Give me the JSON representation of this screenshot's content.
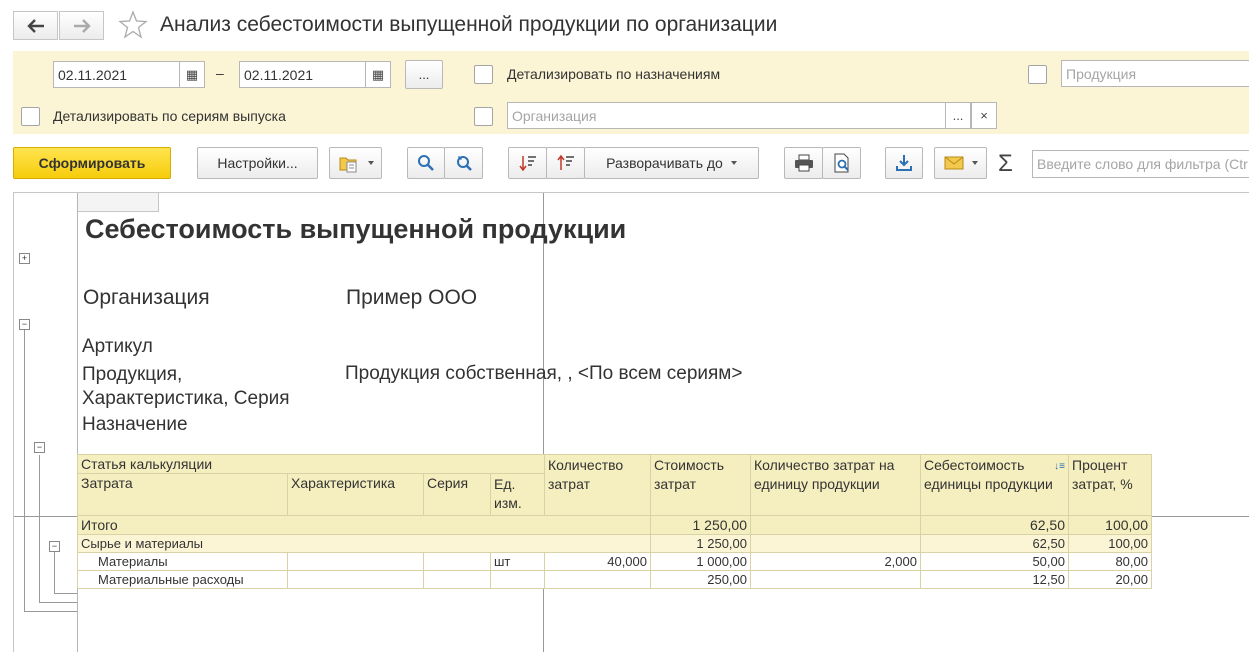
{
  "window": {
    "title": "Анализ себестоимости выпущенной продукции по организации"
  },
  "filters": {
    "date_from": "02.11.2021",
    "date_separator": "–",
    "date_to": "02.11.2021",
    "period_button": "...",
    "detail_by_purpose_label": "Детализировать по назначениям",
    "product_placeholder": "Продукция",
    "detail_by_series_label": "Детализировать по сериям выпуска",
    "organization_placeholder": "Организация",
    "organization_select": "...",
    "organization_clear": "×"
  },
  "toolbar": {
    "generate_label": "Сформировать",
    "settings_label": "Настройки...",
    "expand_label": "Разворачивать до",
    "sum_symbol": "Σ",
    "search_placeholder": "Введите слово для фильтра (Ctr"
  },
  "report": {
    "title": "Себестоимость выпущенной продукции",
    "org_label": "Организация",
    "org_value": "Пример ООО",
    "article_label": "Артикул",
    "product_label": "Продукция,\nХарактеристика, Серия",
    "purpose_label": "Назначение",
    "product_value": "Продукция собственная, , <По всем сериям>",
    "headers": {
      "group": "Статья калькуляции",
      "cost_item": "Затрата",
      "characteristic": "Характеристика",
      "series": "Серия",
      "unit": "Ед. изм.",
      "qty_cost": "Количество затрат",
      "cost_value": "Стоимость затрат",
      "qty_per_unit": "Количество затрат на единицу продукции",
      "unit_cost": "Себестоимость единицы продукции",
      "percent": "Процент затрат, %"
    },
    "rows": [
      {
        "type": "total",
        "name": "Итого",
        "characteristic": "",
        "series": "",
        "unit": "",
        "qty": "",
        "cost": "1 250,00",
        "qty_per_unit": "",
        "unit_cost": "62,50",
        "percent": "100,00"
      },
      {
        "type": "group",
        "name": "Сырье и материалы",
        "characteristic": "",
        "series": "",
        "unit": "",
        "qty": "",
        "cost": "1 250,00",
        "qty_per_unit": "",
        "unit_cost": "62,50",
        "percent": "100,00"
      },
      {
        "type": "item",
        "name": "Материалы",
        "characteristic": "",
        "series": "",
        "unit": "шт",
        "qty": "40,000",
        "cost": "1 000,00",
        "qty_per_unit": "2,000",
        "unit_cost": "50,00",
        "percent": "80,00"
      },
      {
        "type": "item",
        "name": "Материальные расходы",
        "characteristic": "",
        "series": "",
        "unit": "",
        "qty": "",
        "cost": "250,00",
        "qty_per_unit": "",
        "unit_cost": "12,50",
        "percent": "20,00"
      }
    ]
  }
}
